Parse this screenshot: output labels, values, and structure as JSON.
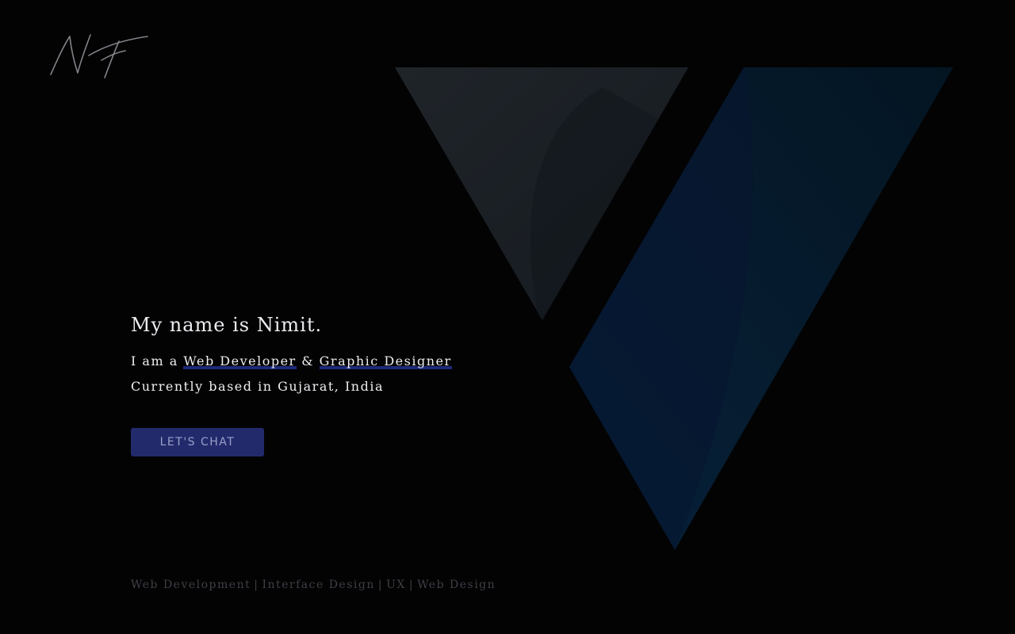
{
  "brand": {
    "logo_text": "NT",
    "logo_icon": "signature-logo-icon"
  },
  "intro": {
    "heading": "My name is Nimit.",
    "role_prefix": "I am a",
    "role_1": "Web Developer",
    "role_joiner": "&",
    "role_2": "Graphic Designer",
    "location": "Currently based in Gujarat, India"
  },
  "cta": {
    "label": "LET'S CHAT"
  },
  "footer": {
    "tags": [
      "Web Development",
      "Interface Design",
      "UX",
      "Web Design"
    ],
    "separator": "|"
  },
  "colors": {
    "background": "#030304",
    "accent": "#232a6c",
    "underline": "#1d2a7a",
    "art_grey": "#1c2127",
    "art_blue": "#061a2b"
  }
}
